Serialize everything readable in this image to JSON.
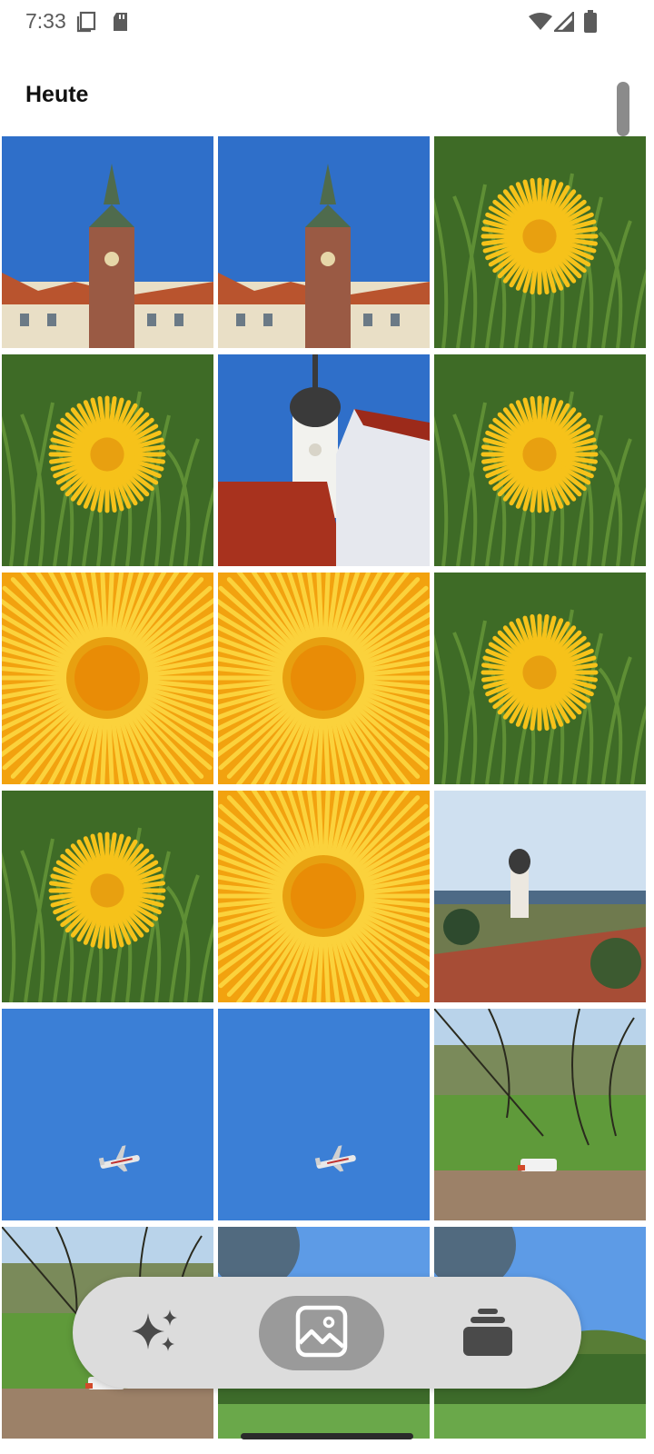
{
  "status": {
    "time": "7:33",
    "icons": [
      "screenshot-icon",
      "sd-card-icon",
      "wifi-icon",
      "cell-signal-icon",
      "battery-icon"
    ]
  },
  "section": {
    "title": "Heute"
  },
  "photos": [
    {
      "subject": "tower-town"
    },
    {
      "subject": "tower-town"
    },
    {
      "subject": "dandelion"
    },
    {
      "subject": "dandelion"
    },
    {
      "subject": "church-tower"
    },
    {
      "subject": "dandelion"
    },
    {
      "subject": "dandelion-closeup"
    },
    {
      "subject": "dandelion-closeup"
    },
    {
      "subject": "dandelion"
    },
    {
      "subject": "dandelion"
    },
    {
      "subject": "dandelion-closeup"
    },
    {
      "subject": "village-church"
    },
    {
      "subject": "airplane-sky"
    },
    {
      "subject": "airplane-sky"
    },
    {
      "subject": "field-tree-car"
    },
    {
      "subject": "field-tree-car"
    },
    {
      "subject": "trees-sky"
    },
    {
      "subject": "trees-sky"
    }
  ],
  "nav": {
    "items": [
      {
        "icon": "sparkles-icon",
        "active": false
      },
      {
        "icon": "image-icon",
        "active": true
      },
      {
        "icon": "stack-icon",
        "active": false
      }
    ]
  },
  "colors": {
    "sky": "#2f6fc9",
    "grass": "#3e6b26",
    "dandelion": "#f6c21a",
    "nav_bg": "#dcdcdc",
    "nav_active": "#9a9a9a"
  }
}
